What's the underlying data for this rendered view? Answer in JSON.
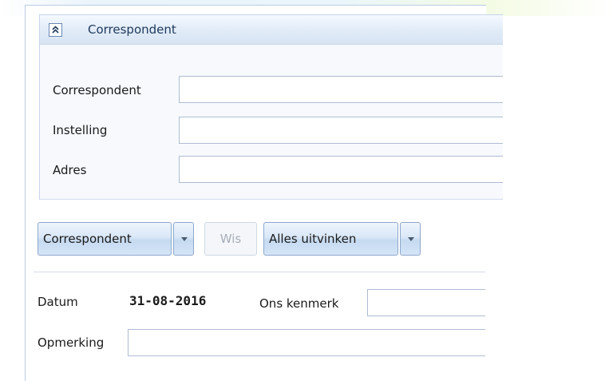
{
  "group": {
    "title": "Correspondent",
    "collapse_icon": "double-chevron-up-icon"
  },
  "fields": {
    "correspondent_label": "Correspondent",
    "correspondent_value": "",
    "instelling_label": "Instelling",
    "instelling_value": "",
    "adres_label": "Adres",
    "adres_value": ""
  },
  "toolbar": {
    "correspondent_button": "Correspondent",
    "wis_button": "Wis",
    "alles_uitvinken_button": "Alles uitvinken"
  },
  "details": {
    "datum_label": "Datum",
    "datum_value": "31-08-2016",
    "ons_kenmerk_label": "Ons kenmerk",
    "ons_kenmerk_value": "",
    "opmerking_label": "Opmerking",
    "opmerking_value": ""
  },
  "colors": {
    "accent": "#1e395b",
    "border": "#b9cde5",
    "button_gradient_mid": "#d9e7f7"
  }
}
